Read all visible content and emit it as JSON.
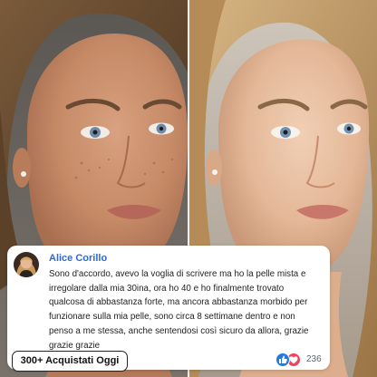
{
  "comment": {
    "author": "Alice Corillo",
    "text": "Sono d'accordo, avevo la voglia di scrivere ma ho la pelle mista e irregolare dalla mia 30ina, ora ho 40 e ho finalmente trovato qualcosa di abbastanza forte, ma ancora abbastanza morbido per funzionare sulla mia pelle, sono circa 8 settimane dentro e non penso a me stessa, anche sentendosi così sicuro da allora, grazie grazie grazie"
  },
  "badge": {
    "label": "300+ Acquistati Oggi"
  },
  "reactions": {
    "count": "236",
    "icons": [
      "like-icon",
      "love-icon"
    ]
  },
  "colors": {
    "author": "#2e6ad1",
    "like": "#1f7ae6",
    "love": "#f04357"
  }
}
